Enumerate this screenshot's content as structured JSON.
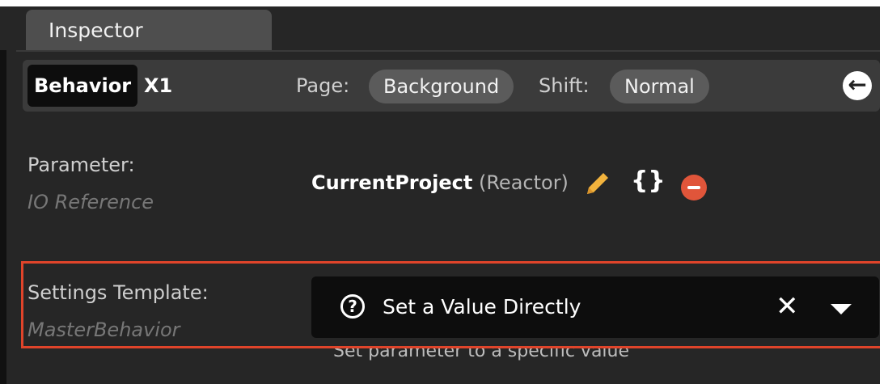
{
  "panel": {
    "tab_label": "Inspector"
  },
  "toolbar": {
    "behavior_label": "Behavior",
    "instance_label": "X1",
    "page_label": "Page:",
    "page_value": "Background",
    "shift_label": "Shift:",
    "shift_value": "Normal"
  },
  "parameter": {
    "label": "Parameter:",
    "sublabel": "IO Reference",
    "value_name": "CurrentProject",
    "value_type": "(Reactor)"
  },
  "settings_template": {
    "label": "Settings Template:",
    "sublabel": "MasterBehavior",
    "selected_value": "Set a Value Directly",
    "hint": "Set parameter to a specific value"
  },
  "colors": {
    "highlight": "#e0442a",
    "pencil": "#f2b33d",
    "remove": "#e0553a"
  }
}
